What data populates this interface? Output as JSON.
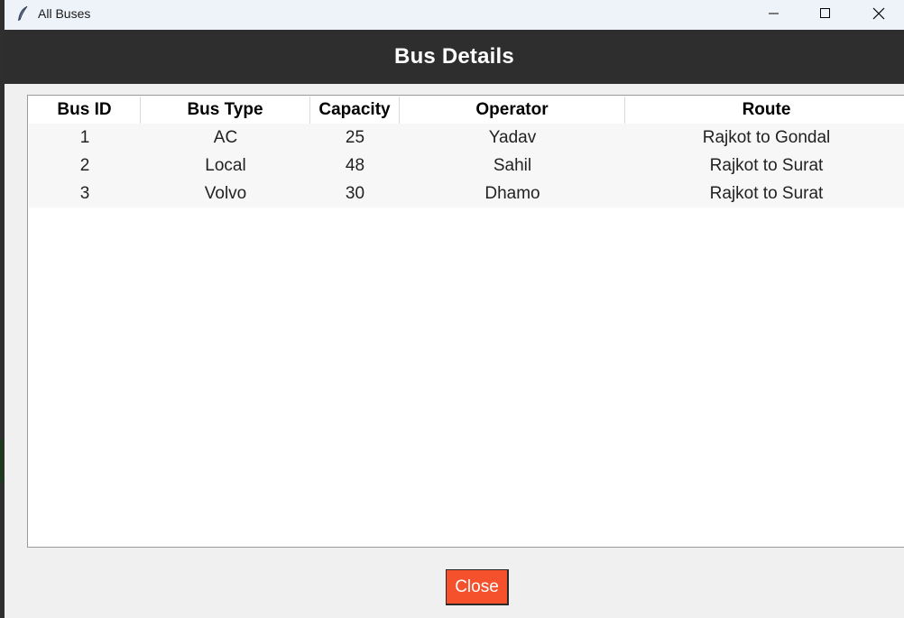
{
  "window": {
    "title": "All Buses"
  },
  "header": {
    "title": "Bus Details"
  },
  "table": {
    "columns": [
      "Bus ID",
      "Bus Type",
      "Capacity",
      "Operator",
      "Route"
    ],
    "rows": [
      [
        "1",
        "AC",
        "25",
        "Yadav",
        "Rajkot to Gondal"
      ],
      [
        "2",
        "Local",
        "48",
        "Sahil",
        "Rajkot to Surat"
      ],
      [
        "3",
        "Volvo",
        "30",
        "Dhamo",
        "Rajkot to Surat"
      ]
    ]
  },
  "footer": {
    "close_label": "Close"
  },
  "colors": {
    "header_bg": "#2e2e2e",
    "close_button_bg": "#f4512c",
    "titlebar_bg": "#eef2f9"
  }
}
